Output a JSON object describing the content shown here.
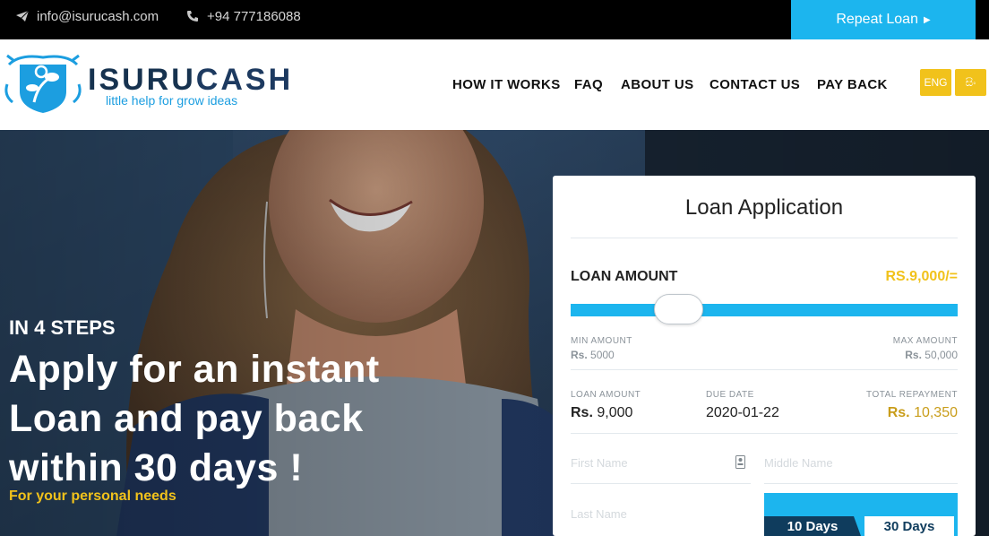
{
  "topbar": {
    "email": "info@isurucash.com",
    "phone": "+94 777186088",
    "repeat_loan": "Repeat Loan"
  },
  "brand": {
    "name_part1": "ISURU",
    "name_part2": "CASH",
    "tagline": "little help for grow ideas"
  },
  "nav": {
    "items": [
      "HOW IT WORKS",
      "FAQ",
      "ABOUT US",
      "CONTACT US",
      "PAY BACK"
    ],
    "lang_en": "ENG",
    "lang_si": "සිං"
  },
  "hero": {
    "steps": "IN 4 STEPS",
    "headline": "Apply for an instant Loan and pay back within 30 days !",
    "subline": "For your personal needs"
  },
  "loan_form": {
    "title": "Loan Application",
    "amount_label": "LOAN AMOUNT",
    "amount_value": "RS.9,000/=",
    "slider_fraction": 0.089,
    "min_label": "MIN AMOUNT",
    "min_currency": "Rs.",
    "min_value": "5000",
    "max_label": "MAX AMOUNT",
    "max_currency": "Rs.",
    "max_value": "50,000",
    "summary": {
      "loan_label": "LOAN AMOUNT",
      "loan_currency": "Rs.",
      "loan_value": "9,000",
      "due_label": "DUE DATE",
      "due_value": "2020-01-22",
      "total_label": "TOTAL REPAYMENT",
      "total_currency": "Rs.",
      "total_value": "10,350"
    },
    "fields": {
      "first_name": "First Name",
      "middle_name": "Middle Name",
      "last_name": "Last Name"
    },
    "term_10": "10 Days",
    "term_30": "30 Days"
  },
  "colors": {
    "accent_blue": "#1cb5ee",
    "accent_gold": "#f1c21b",
    "navy": "#16324f"
  }
}
